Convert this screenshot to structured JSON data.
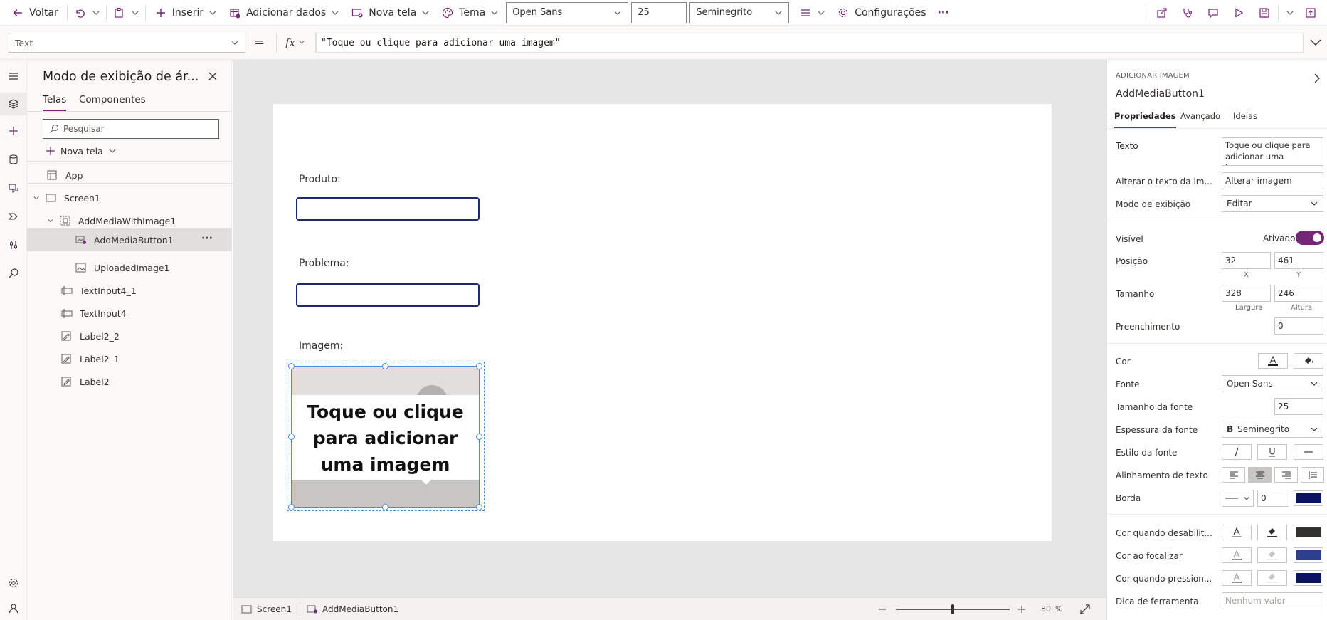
{
  "toolbar": {
    "back": "Voltar",
    "insert": "Inserir",
    "add_data": "Adicionar dados",
    "new_screen": "Nova tela",
    "theme": "Tema",
    "font_value": "Open Sans",
    "font_size_value": "25",
    "font_weight_value": "Seminegrito",
    "settings": "Configurações",
    "more": "···"
  },
  "formula_bar": {
    "property": "Text",
    "equals": "=",
    "fx": "fx",
    "formula": "\"Toque ou clique para adicionar uma imagem\""
  },
  "tree": {
    "title": "Modo de exibição de ár...",
    "tabs": [
      "Telas",
      "Componentes"
    ],
    "active_tab": "Telas",
    "search_placeholder": "Pesquisar",
    "new_screen": "Nova tela",
    "app": "App",
    "nodes": [
      "Screen1",
      "AddMediaWithImage1",
      "AddMediaButton1",
      "UploadedImage1",
      "TextInput4_1",
      "TextInput4",
      "Label2_2",
      "Label2_1",
      "Label2"
    ],
    "selected": "AddMediaButton1",
    "more": "···"
  },
  "canvas": {
    "label_produto": "Produto:",
    "label_problema": "Problema:",
    "label_imagem": "Imagem:",
    "add_image_text": "Toque ou clique para adicionar uma imagem"
  },
  "status": {
    "screen": "Screen1",
    "control": "AddMediaButton1",
    "zoom_value": "80",
    "zoom_unit": "%",
    "zoom_fraction": 0.8
  },
  "props": {
    "category": "ADICIONAR IMAGEM",
    "control_name": "AddMediaButton1",
    "tabs": [
      "Propriedades",
      "Avançado",
      "Ideias"
    ],
    "active_tab": "Propriedades",
    "texto_label": "Texto",
    "texto_value": "Toque ou clique para adicionar uma imagem",
    "change_text_label": "Alterar o texto da im...",
    "change_text_value": "Alterar imagem",
    "display_mode_label": "Modo de exibição",
    "display_mode_value": "Editar",
    "visible_label": "Visível",
    "visible_value": "Ativado",
    "visible_on": true,
    "position_label": "Posição",
    "x": "32",
    "x_label": "X",
    "y": "461",
    "y_label": "Y",
    "size_label": "Tamanho",
    "width": "328",
    "width_label": "Largura",
    "height": "246",
    "height_label": "Altura",
    "padding_label": "Preenchimento",
    "padding": "0",
    "color_label": "Cor",
    "font_label": "Fonte",
    "font_value": "Open Sans",
    "font_size_label": "Tamanho da fonte",
    "font_size_value": "25",
    "font_weight_label": "Espessura da fonte",
    "font_weight_value": "Seminegrito",
    "font_weight_glyph": "B",
    "font_style_label": "Estilo da fonte",
    "text_align_label": "Alinhamento de texto",
    "border_label": "Borda",
    "border_value": "0",
    "disabled_color_label": "Cor quando desabilit...",
    "hover_color_label": "Cor ao focalizar",
    "pressed_color_label": "Cor quando pression...",
    "tooltip_label": "Dica de ferramenta",
    "tooltip_placeholder": "Nenhum valor"
  },
  "colors": {
    "accent": "#742774",
    "border_navy": "#0b1461",
    "disabled_fill": "#323130",
    "hover_fill": "#2e3e8f",
    "pressed_fill": "#0b1461",
    "input_border": "#1c2b6b"
  }
}
